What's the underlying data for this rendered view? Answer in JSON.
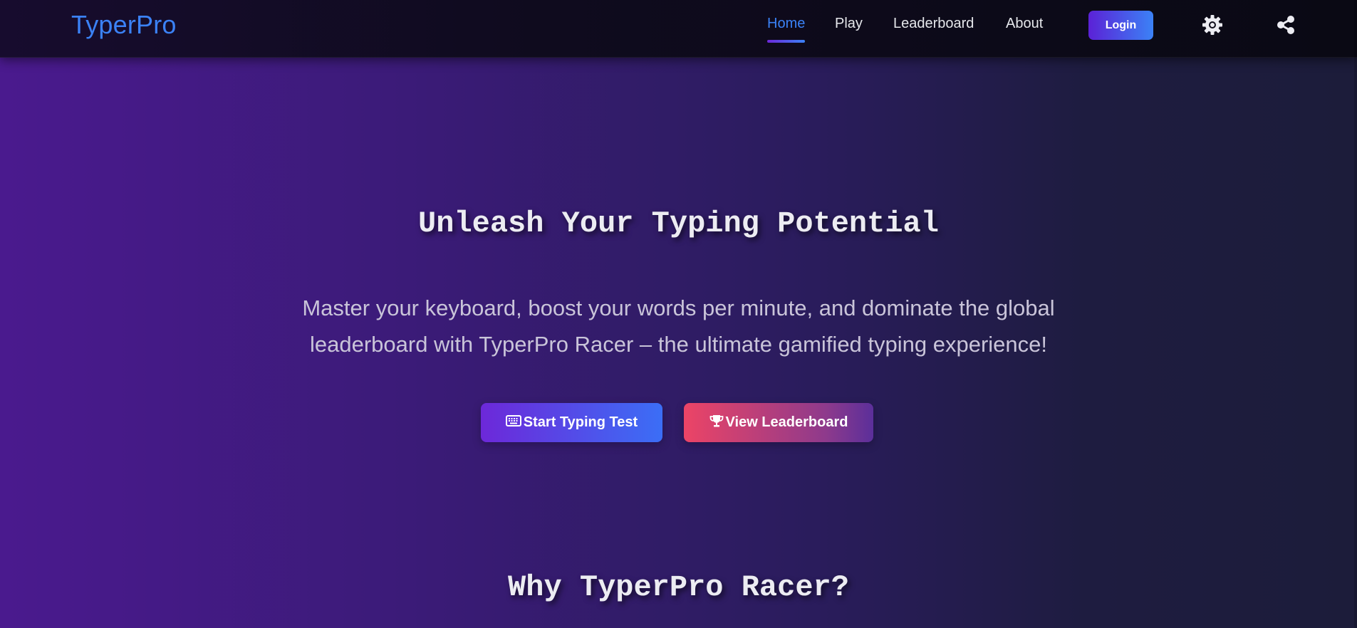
{
  "app": {
    "logo": "TyperPro"
  },
  "nav": {
    "items": [
      {
        "label": "Home",
        "active": true
      },
      {
        "label": "Play"
      },
      {
        "label": "Leaderboard"
      },
      {
        "label": "About"
      }
    ],
    "login_label": "Login",
    "settings_icon": "gear-icon",
    "share_icon": "share-icon"
  },
  "hero": {
    "title": "Unleash Your Typing Potential",
    "subtitle": "Master your keyboard, boost your words per minute, and dominate the global leaderboard with TyperPro Racer – the ultimate gamified typing experience!",
    "primary_cta": {
      "icon": "keyboard-icon",
      "label": "Start Typing Test"
    },
    "secondary_cta": {
      "icon": "trophy-icon",
      "label": "View Leaderboard"
    }
  },
  "features": {
    "title": "Why TyperPro Racer?"
  },
  "colors": {
    "accent": "#3b82f6",
    "primary_gradient_start": "#6d28d9",
    "secondary_gradient_start": "#ec4466"
  }
}
